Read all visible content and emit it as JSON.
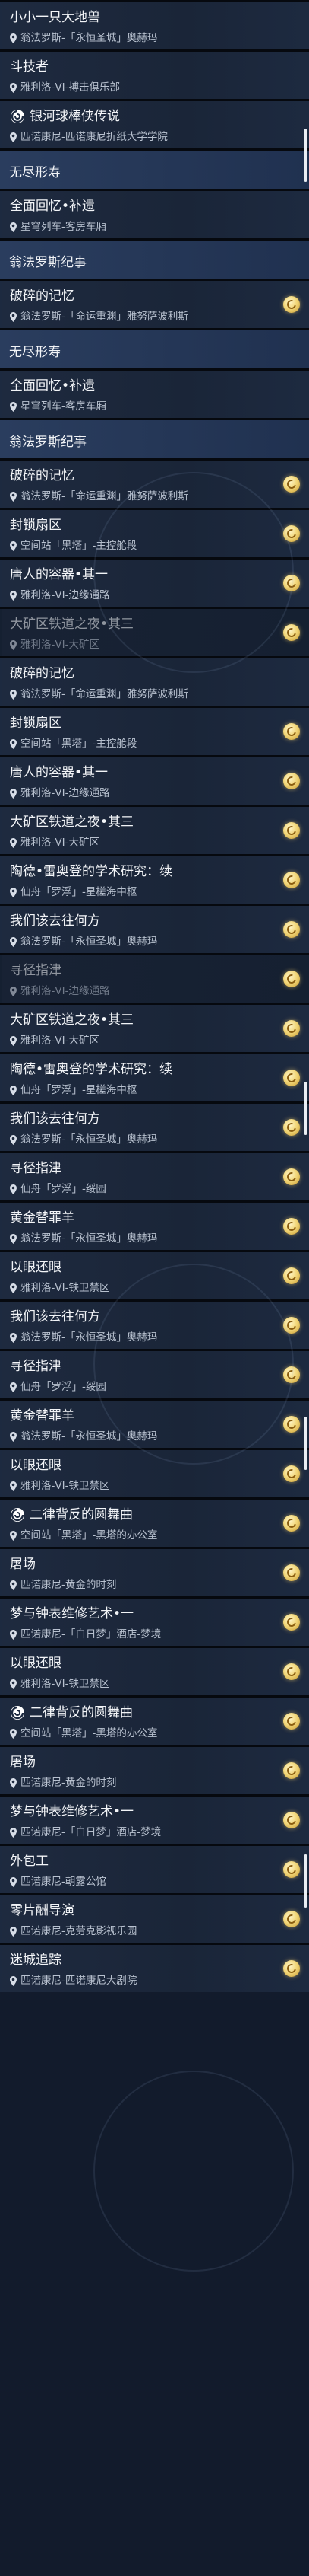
{
  "quests": [
    {
      "type": "row",
      "title": "小小一只大地兽",
      "location": "翁法罗斯-「永恒圣城」奥赫玛",
      "icon": "",
      "mark": "none",
      "state": "normal"
    },
    {
      "type": "row",
      "title": "斗技者",
      "location": "雅利洛-VI-搏击俱乐部",
      "icon": "",
      "mark": "none",
      "state": "normal"
    },
    {
      "type": "row",
      "title": "银河球棒侠传说",
      "location": "匹诺康尼-匹诺康尼折纸大学学院",
      "icon": "swirl-icon",
      "mark": "none",
      "state": "normal"
    },
    {
      "type": "header",
      "title": "无尽形寿"
    },
    {
      "type": "row",
      "title": "全面回忆•补遗",
      "location": "星穹列车-客房车厢",
      "icon": "",
      "mark": "none",
      "state": "normal"
    },
    {
      "type": "header",
      "title": "翁法罗斯纪事"
    },
    {
      "type": "row",
      "title": "破碎的记忆",
      "location": "翁法罗斯-「命运重渊」雅努萨波利斯",
      "icon": "",
      "mark": "small",
      "state": "normal"
    },
    {
      "type": "header",
      "title": "无尽形寿"
    },
    {
      "type": "row",
      "title": "全面回忆•补遗",
      "location": "星穹列车-客房车厢",
      "icon": "",
      "mark": "none",
      "state": "normal"
    },
    {
      "type": "header",
      "title": "翁法罗斯纪事"
    },
    {
      "type": "row",
      "title": "破碎的记忆",
      "location": "翁法罗斯-「命运重渊」雅努萨波利斯",
      "icon": "",
      "mark": "small",
      "state": "normal"
    },
    {
      "type": "row",
      "title": "封锁扇区",
      "location": "空间站「黑塔」-主控舱段",
      "icon": "",
      "mark": "small",
      "state": "normal"
    },
    {
      "type": "row",
      "title": "唐人的容器•其一",
      "location": "雅利洛-VI-边缘通路",
      "icon": "",
      "mark": "small",
      "state": "normal"
    },
    {
      "type": "row",
      "title": "大矿区铁道之夜•其三",
      "location": "雅利洛-VI-大矿区",
      "icon": "",
      "mark": "small",
      "state": "dim"
    },
    {
      "type": "row",
      "title": "破碎的记忆",
      "location": "翁法罗斯-「命运重渊」雅努萨波利斯",
      "icon": "",
      "mark": "none",
      "state": "normal"
    },
    {
      "type": "row",
      "title": "封锁扇区",
      "location": "空间站「黑塔」-主控舱段",
      "icon": "",
      "mark": "small",
      "state": "normal"
    },
    {
      "type": "row",
      "title": "唐人的容器•其一",
      "location": "雅利洛-VI-边缘通路",
      "icon": "",
      "mark": "small",
      "state": "normal"
    },
    {
      "type": "row",
      "title": "大矿区铁道之夜•其三",
      "location": "雅利洛-VI-大矿区",
      "icon": "",
      "mark": "small",
      "state": "normal"
    },
    {
      "type": "row",
      "title": "陶德•雷奥登的学术研究：续",
      "location": "仙舟「罗浮」-星槎海中枢",
      "icon": "",
      "mark": "small",
      "state": "normal"
    },
    {
      "type": "row",
      "title": "我们该去往何方",
      "location": "翁法罗斯-「永恒圣城」奥赫玛",
      "icon": "",
      "mark": "small",
      "state": "normal"
    },
    {
      "type": "row",
      "title": "寻径指津",
      "location": "雅利洛-VI-边缘通路",
      "icon": "",
      "mark": "small",
      "state": "dim"
    },
    {
      "type": "row",
      "title": "大矿区铁道之夜•其三",
      "location": "雅利洛-VI-大矿区",
      "icon": "",
      "mark": "small",
      "state": "normal"
    },
    {
      "type": "row",
      "title": "陶德•雷奥登的学术研究：续",
      "location": "仙舟「罗浮」-星槎海中枢",
      "icon": "",
      "mark": "small",
      "state": "normal"
    },
    {
      "type": "row",
      "title": "我们该去往何方",
      "location": "翁法罗斯-「永恒圣城」奥赫玛",
      "icon": "",
      "mark": "small",
      "state": "normal"
    },
    {
      "type": "row",
      "title": "寻径指津",
      "location": "仙舟「罗浮」-绥园",
      "icon": "",
      "mark": "small",
      "state": "normal"
    },
    {
      "type": "row",
      "title": "黄金替罪羊",
      "location": "翁法罗斯-「永恒圣城」奥赫玛",
      "icon": "",
      "mark": "small",
      "state": "normal"
    },
    {
      "type": "row",
      "title": "以眼还眼",
      "location": "雅利洛-VI-铁卫禁区",
      "icon": "",
      "mark": "small",
      "state": "normal"
    },
    {
      "type": "row",
      "title": "我们该去往何方",
      "location": "翁法罗斯-「永恒圣城」奥赫玛",
      "icon": "",
      "mark": "small",
      "state": "normal"
    },
    {
      "type": "row",
      "title": "寻径指津",
      "location": "仙舟「罗浮」-绥园",
      "icon": "",
      "mark": "small",
      "state": "normal"
    },
    {
      "type": "row",
      "title": "黄金替罪羊",
      "location": "翁法罗斯-「永恒圣城」奥赫玛",
      "icon": "",
      "mark": "small",
      "state": "normal"
    },
    {
      "type": "row",
      "title": "以眼还眼",
      "location": "雅利洛-VI-铁卫禁区",
      "icon": "",
      "mark": "small",
      "state": "normal"
    },
    {
      "type": "row",
      "title": "二律背反的圆舞曲",
      "location": "空间站「黑塔」-黑塔的办公室",
      "icon": "swirl-icon",
      "mark": "small",
      "state": "normal"
    },
    {
      "type": "row",
      "title": "屠场",
      "location": "匹诺康尼-黄金的时刻",
      "icon": "",
      "mark": "small",
      "state": "normal"
    },
    {
      "type": "row",
      "title": "梦与钟表维修艺术•一",
      "location": "匹诺康尼-「白日梦」酒店-梦境",
      "icon": "",
      "mark": "small",
      "state": "normal"
    },
    {
      "type": "row",
      "title": "以眼还眼",
      "location": "雅利洛-VI-铁卫禁区",
      "icon": "",
      "mark": "small",
      "state": "normal"
    },
    {
      "type": "row",
      "title": "二律背反的圆舞曲",
      "location": "空间站「黑塔」-黑塔的办公室",
      "icon": "swirl-icon",
      "mark": "small",
      "state": "normal"
    },
    {
      "type": "row",
      "title": "屠场",
      "location": "匹诺康尼-黄金的时刻",
      "icon": "",
      "mark": "small",
      "state": "normal"
    },
    {
      "type": "row",
      "title": "梦与钟表维修艺术•一",
      "location": "匹诺康尼-「白日梦」酒店-梦境",
      "icon": "",
      "mark": "small",
      "state": "normal"
    },
    {
      "type": "row",
      "title": "外包工",
      "location": "匹诺康尼-朝露公馆",
      "icon": "",
      "mark": "small",
      "state": "normal"
    },
    {
      "type": "row",
      "title": "零片酬导演",
      "location": "匹诺康尼-克劳克影视乐园",
      "icon": "",
      "mark": "small",
      "state": "normal"
    },
    {
      "type": "row",
      "title": "迷城追踪",
      "location": "匹诺康尼-匹诺康尼大剧院",
      "icon": "",
      "mark": "small",
      "state": "normal"
    }
  ],
  "colors": {
    "accent_gold": "#f2d77a",
    "background": "#121b2c",
    "row": "#1e2a3f",
    "header": "#2a3d5e",
    "text": "#f2f4f7",
    "subtext": "#b8c1cf"
  },
  "scroll_positions": [
    0.05,
    0.42,
    0.55,
    0.72
  ]
}
